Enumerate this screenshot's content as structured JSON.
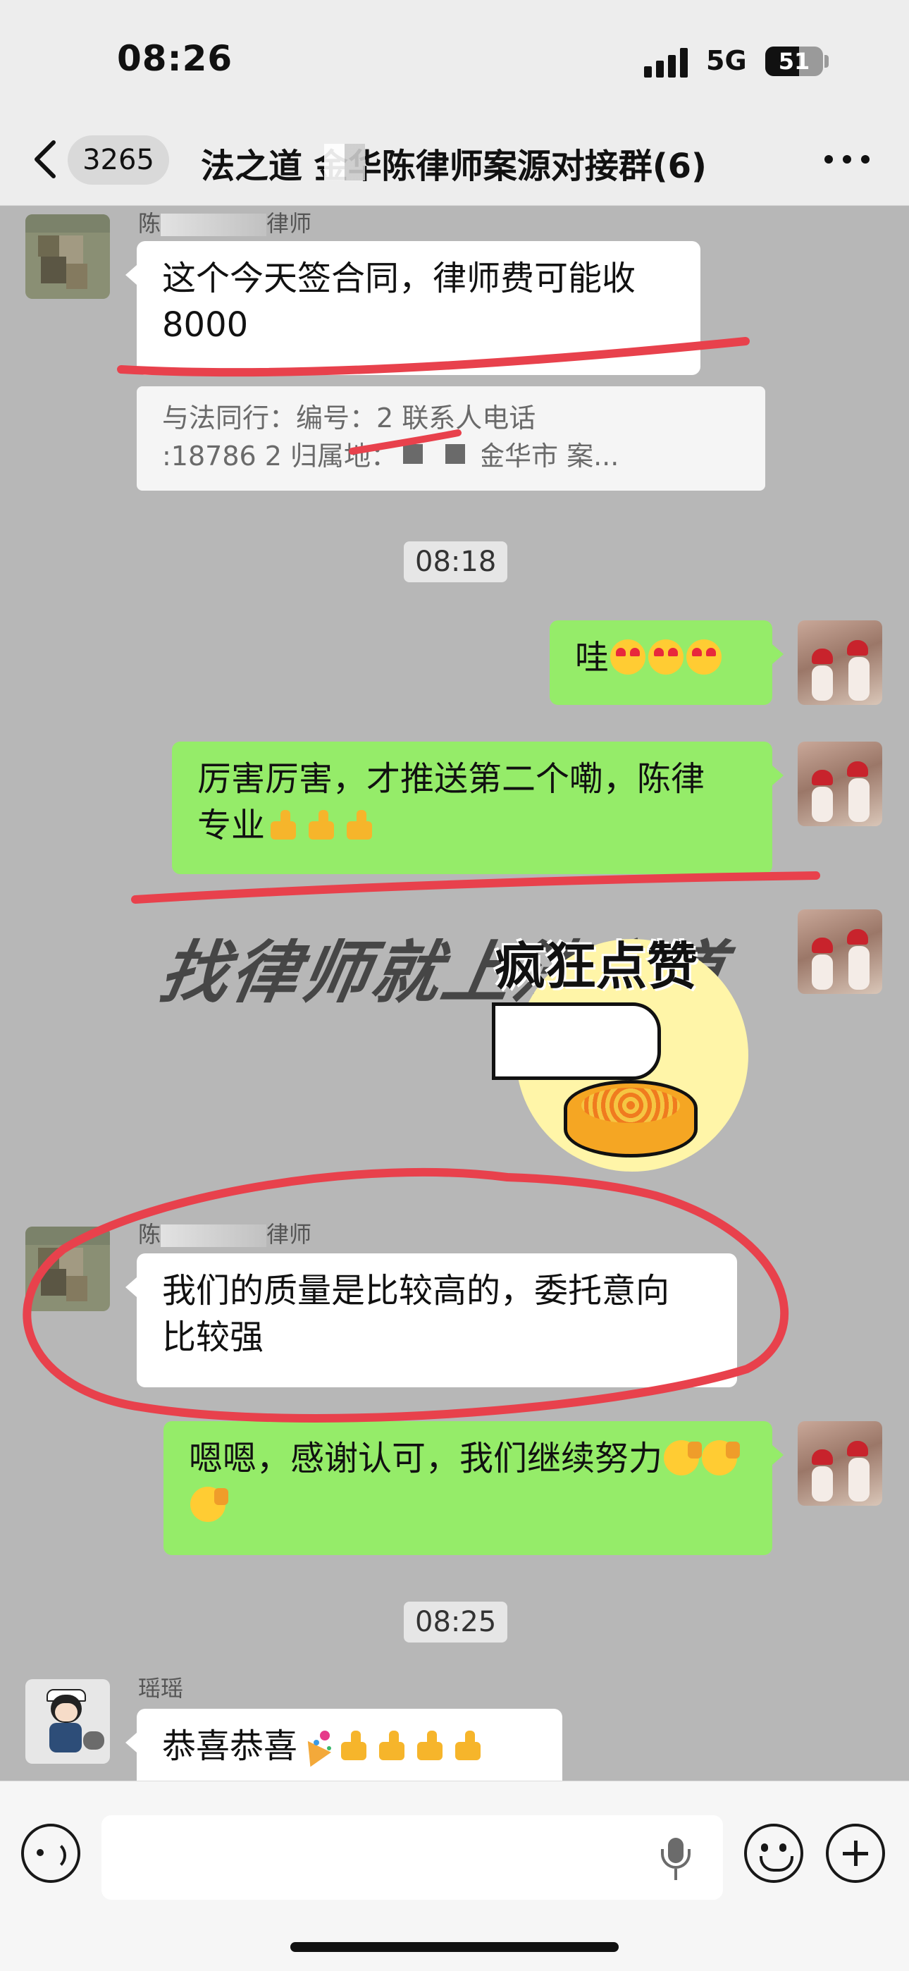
{
  "status_bar": {
    "time": "08:26",
    "network": "5G",
    "battery": "51"
  },
  "header": {
    "unread_count": "3265",
    "title": "法之道  金华陈律师案源对接群(6)"
  },
  "messages": [
    {
      "sender": "陈律师",
      "sender_prefix": "陈",
      "sender_suffix": "律师",
      "direction": "incoming",
      "text": "这个今天签合同，律师费可能收\n8000"
    },
    {
      "type": "quote",
      "line1": "与法同行：编号：2 联系人电话",
      "line2": ":18786     2 归属地：浙江省金华市 案..."
    },
    {
      "type": "time",
      "text": "08:18"
    },
    {
      "direction": "outgoing",
      "text": "哇"
    },
    {
      "direction": "outgoing",
      "text": "厉害厉害，才推送第二个嘞，陈律\n专业"
    },
    {
      "type": "sticker",
      "direction": "outgoing",
      "banner_text": "找律师就上法之道",
      "caption": "疯狂点赞"
    },
    {
      "sender_prefix": "陈",
      "sender_suffix": "律师",
      "direction": "incoming",
      "text": "我们的质量是比较高的，委托意向\n比较强"
    },
    {
      "direction": "outgoing",
      "text": "嗯嗯，感谢认可，我们继续努力"
    },
    {
      "type": "time",
      "text": "08:25"
    },
    {
      "sender": "瑶瑶",
      "direction": "incoming",
      "text": "恭喜恭喜"
    }
  ],
  "colors": {
    "chat_background": "#b7b7b7",
    "outgoing_bubble": "#95ec69",
    "incoming_bubble": "#ffffff",
    "annotation_red": "#e8414c"
  },
  "icons": [
    "back-icon",
    "more-icon",
    "voice-icon",
    "mic-icon",
    "emoji-icon",
    "plus-icon"
  ]
}
